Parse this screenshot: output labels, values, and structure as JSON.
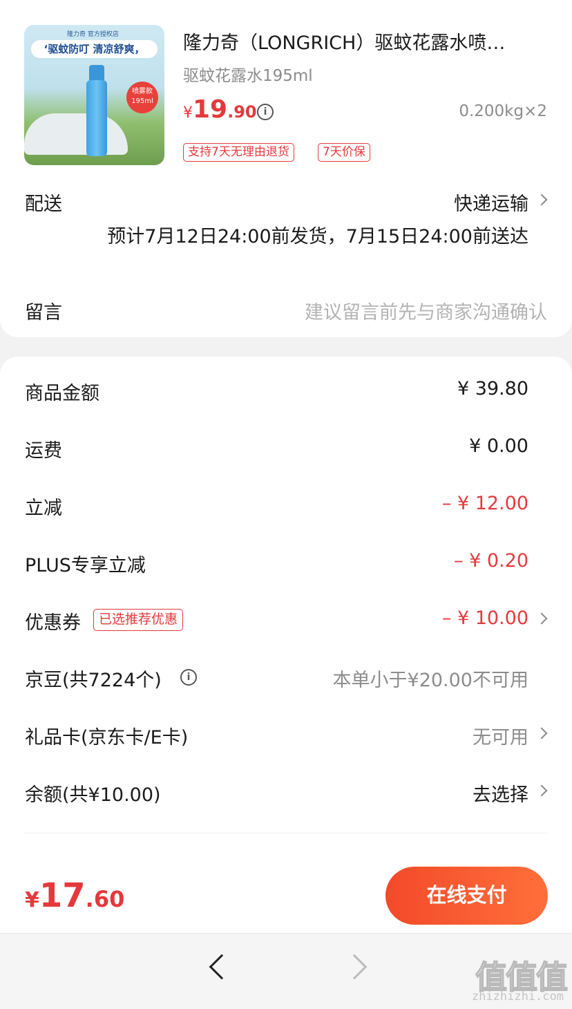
{
  "product": {
    "title": "隆力奇（LONGRICH）驱蚊花露水喷…",
    "spec": "驱蚊花露水195ml",
    "price_symbol": "¥",
    "price_int": "19",
    "price_dec": ".90",
    "weight": "0.200kg×2",
    "tags": [
      "支持7天无理由退货",
      "7天价保"
    ],
    "image": {
      "brand_line": "隆力奇 官方授权店",
      "banner": "‘驱蚊防叮 清凉舒爽，",
      "badge_line1": "喷雾款",
      "badge_line2": "195ml"
    }
  },
  "delivery": {
    "label": "配送",
    "method": "快递运输",
    "estimate": "预计7月12日24:00前发货，7月15日24:00前送达"
  },
  "message": {
    "label": "留言",
    "placeholder": "建议留言前先与商家沟通确认"
  },
  "summary": [
    {
      "label": "商品金额",
      "value": "¥ 39.80"
    },
    {
      "label": "运费",
      "value": "¥ 0.00"
    },
    {
      "label": "立减",
      "value": "– ¥ 12.00"
    },
    {
      "label": "PLUS专享立减",
      "value": "– ¥ 0.20"
    },
    {
      "label": "优惠券",
      "tag": "已选推荐优惠",
      "value": "– ¥ 10.00"
    },
    {
      "label": "京豆(共7224个)",
      "value": "本单小于¥20.00不可用"
    },
    {
      "label": "礼品卡(京东卡/E卡)",
      "value": "无可用"
    },
    {
      "label": "余额(共¥10.00)",
      "value": "去选择"
    }
  ],
  "footer": {
    "total_symbol": "¥",
    "total_int": "17",
    "total_dec": ".60",
    "pay_button": "在线支付"
  },
  "watermark": {
    "text": "值值值",
    "url": "zhizhizhi.com"
  },
  "colors": {
    "accent": "#e4393c",
    "button_gradient_start": "#f34a2a",
    "button_gradient_end": "#ff6f3a"
  }
}
